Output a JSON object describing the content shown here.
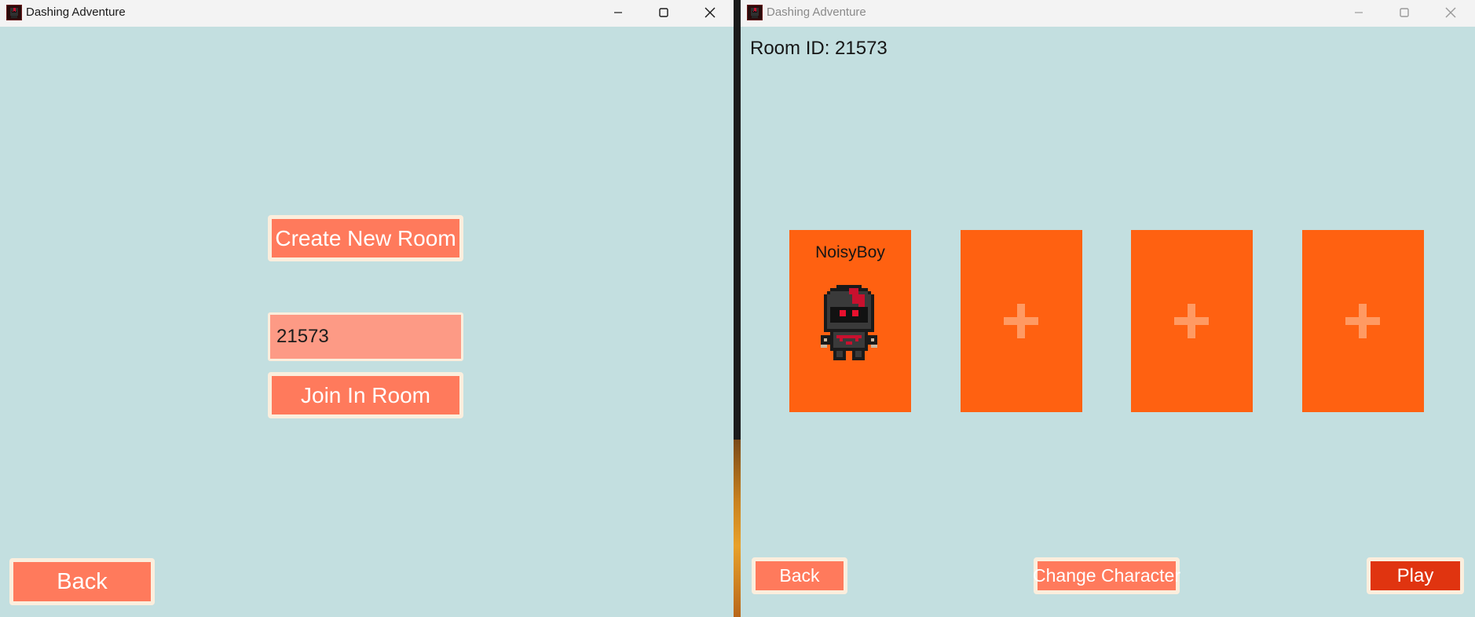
{
  "app": {
    "title": "Dashing Adventure"
  },
  "left_window": {
    "create_room_label": "Create New Room",
    "room_code_input": "21573",
    "join_room_label": "Join In Room",
    "back_label": "Back"
  },
  "right_window": {
    "room_id_text": "Room ID: 21573",
    "slots": [
      {
        "player_name": "NoisyBoy",
        "state": "occupied",
        "character_icon": "ninja-character-icon"
      },
      {
        "player_name": "",
        "state": "empty",
        "icon": "plus-icon"
      },
      {
        "player_name": "",
        "state": "empty",
        "icon": "plus-icon"
      },
      {
        "player_name": "",
        "state": "empty",
        "icon": "plus-icon"
      }
    ],
    "back_label": "Back",
    "change_character_label": "Change Character",
    "play_label": "Play"
  },
  "colors": {
    "background": "#c3dfe0",
    "button": "#ff7a5c",
    "button_border": "#fbeedd",
    "input": "#fd9a85",
    "slot": "#ff6111",
    "play_button": "#e03410",
    "plus": "#ff9a63"
  }
}
